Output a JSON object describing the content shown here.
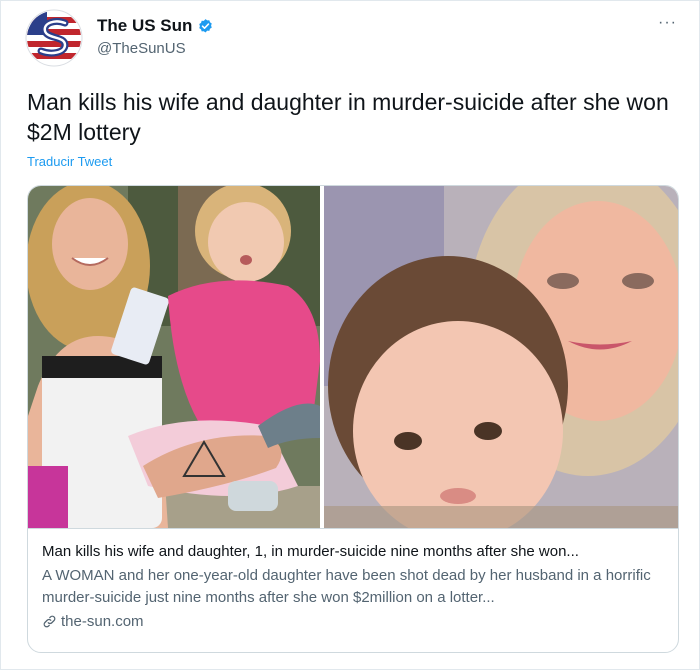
{
  "account": {
    "name": "The US Sun",
    "handle": "@TheSunUS",
    "avatar_icon": "the-us-sun-logo",
    "verified_icon": "verified-badge-icon"
  },
  "tweet": {
    "text": "Man kills his wife and daughter in murder-suicide after she won $2M lottery",
    "translate_label": "Traducir Tweet",
    "more_label": "···"
  },
  "card": {
    "title": "Man kills his wife and daughter, 1, in murder-suicide nine months after she won...",
    "description": "A WOMAN and her one-year-old daughter have been shot dead by her husband in a horrific murder-suicide just nine months after she won $2million on a lotter...",
    "domain": "the-sun.com",
    "link_icon": "link-icon"
  },
  "colors": {
    "accent": "#1d9bf0",
    "text_primary": "#0f1419",
    "text_secondary": "#536471",
    "border": "#cfd9de"
  }
}
